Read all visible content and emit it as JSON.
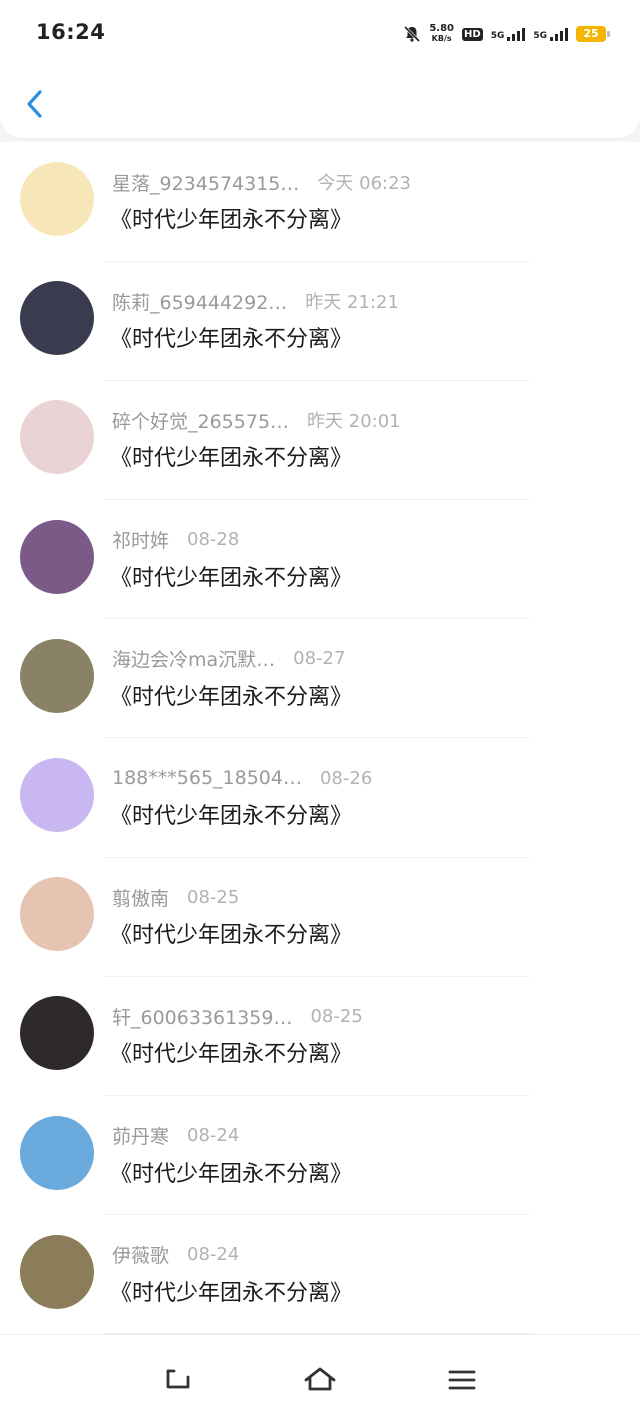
{
  "status_bar": {
    "time": "16:24",
    "net_speed_value": "5.80",
    "net_speed_unit": "KB/s",
    "hd_label": "HD",
    "sim1_label": "5G",
    "sim2_label": "5G",
    "battery_level": "25",
    "icons": [
      "mute-icon",
      "hd-icon",
      "signal-icon",
      "signal-icon",
      "battery-icon"
    ]
  },
  "header": {
    "back_icon": "chevron-left-icon",
    "accent_color": "#2b8fe0"
  },
  "messages": [
    {
      "name": "星落_9234574315…",
      "time": "今天 06:23",
      "text": "《时代少年团永不分离》",
      "avatar_color": "#f7e7b8"
    },
    {
      "name": "陈莉_659444292…",
      "time": "昨天 21:21",
      "text": "《时代少年团永不分离》",
      "avatar_color": "#3a3b4e"
    },
    {
      "name": "碎个好觉_265575…",
      "time": "昨天 20:01",
      "text": "《时代少年团永不分离》",
      "avatar_color": "#e9d3d4"
    },
    {
      "name": "祁时姩",
      "time": "08-28",
      "text": "《时代少年团永不分离》",
      "avatar_color": "#7c5a88"
    },
    {
      "name": "海边会冷ma沉默…",
      "time": "08-27",
      "text": "《时代少年团永不分离》",
      "avatar_color": "#8a8266"
    },
    {
      "name": "188***565_18504…",
      "time": "08-26",
      "text": "《时代少年团永不分离》",
      "avatar_color": "#c9b7f2"
    },
    {
      "name": "翦傲南",
      "time": "08-25",
      "text": "《时代少年团永不分离》",
      "avatar_color": "#e5c4b2"
    },
    {
      "name": "轩_60063361359…",
      "time": "08-25",
      "text": "《时代少年团永不分离》",
      "avatar_color": "#2e2a2c"
    },
    {
      "name": "茆丹寒",
      "time": "08-24",
      "text": "《时代少年团永不分离》",
      "avatar_color": "#6aa9dc"
    },
    {
      "name": "伊薇歌",
      "time": "08-24",
      "text": "《时代少年团永不分离》",
      "avatar_color": "#8b7c5a"
    }
  ],
  "nav_bar": {
    "icons": [
      "back-nav-icon",
      "home-icon",
      "menu-icon"
    ]
  }
}
